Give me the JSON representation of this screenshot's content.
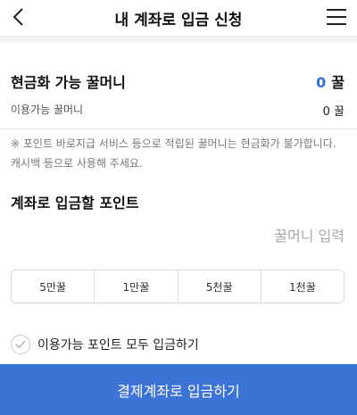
{
  "header": {
    "title": "내 계좌로 입금 신청",
    "back_icon": "chevron-left-icon",
    "menu_icon": "hamburger-menu-icon"
  },
  "cashable": {
    "label": "현금화 가능 꿀머니",
    "value": "0",
    "unit": "꿀",
    "value_color": "#2f6fd3"
  },
  "available": {
    "label": "이용가능 꿀머니",
    "value": "0 꿀"
  },
  "notice": "※ 포인트 바로지급 서비스 등으로 적립된 꿀머니는 현금화가 불가합니다. 캐시백 등으로 사용해 주세요.",
  "deposit": {
    "title": "계좌로 입금할 포인트",
    "placeholder": "꿀머니 입력",
    "value": ""
  },
  "quick_amounts": [
    "5만꿀",
    "1만꿀",
    "5천꿀",
    "1천꿀"
  ],
  "use_all": {
    "label": "이용가능 포인트 모두 입금하기",
    "checked": false,
    "icon": "check-icon"
  },
  "submit": {
    "label": "결제계좌로 입금하기",
    "color": "#3b73d6"
  }
}
